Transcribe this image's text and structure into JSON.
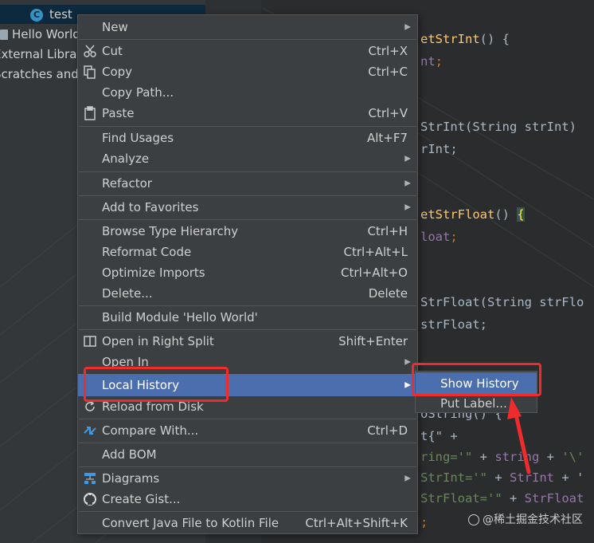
{
  "project_tree": {
    "items": [
      {
        "label": "test",
        "icon": "class-icon",
        "badge": "C"
      },
      {
        "label": "Hello World",
        "icon": "module-icon"
      },
      {
        "label": "External Libraries"
      },
      {
        "label": "Scratches and Consoles"
      }
    ]
  },
  "editor": {
    "code_lines": [
      {
        "seg": [
          {
            "t": "etStrInt",
            "c": "fn"
          },
          {
            "t": "() {",
            "c": ""
          }
        ]
      },
      {
        "seg": [
          {
            "t": "nt",
            "c": "field"
          },
          {
            "t": ";",
            "c": "kw"
          }
        ]
      },
      {
        "seg": [
          {
            "t": "StrInt(String strInt)",
            "c": ""
          }
        ]
      },
      {
        "seg": [
          {
            "t": "rInt;",
            "c": ""
          }
        ]
      },
      {
        "seg": [
          {
            "t": "etStrFloat",
            "c": "fn"
          },
          {
            "t": "() ",
            "c": ""
          },
          {
            "t": "{",
            "c": "brace"
          }
        ]
      },
      {
        "seg": [
          {
            "t": "loat",
            "c": "field"
          },
          {
            "t": ";",
            "c": "kw"
          }
        ]
      },
      {
        "seg": [
          {
            "t": "StrFloat(String strFlo",
            "c": ""
          }
        ]
      },
      {
        "seg": [
          {
            "t": "strFloat;",
            "c": ""
          }
        ]
      },
      {
        "seg": [
          {
            "t": "oString() {",
            "c": ""
          }
        ]
      },
      {
        "seg": [
          {
            "t": "t{\" +",
            "c": ""
          }
        ]
      },
      {
        "seg": [
          {
            "t": "ring='\"",
            "c": "str"
          },
          {
            "t": " + ",
            "c": ""
          },
          {
            "t": "string",
            "c": "field"
          },
          {
            "t": " + ",
            "c": ""
          },
          {
            "t": "'\\'",
            "c": "str"
          }
        ]
      },
      {
        "seg": [
          {
            "t": "StrInt='\"",
            "c": "str"
          },
          {
            "t": " + ",
            "c": ""
          },
          {
            "t": "StrInt",
            "c": "field"
          },
          {
            "t": " + '",
            "c": ""
          }
        ]
      },
      {
        "seg": [
          {
            "t": "StrFloat='\"",
            "c": "str"
          },
          {
            "t": " + ",
            "c": ""
          },
          {
            "t": "StrFloat",
            "c": "field"
          }
        ]
      },
      {
        "seg": [
          {
            "t": ";",
            "c": "kw"
          }
        ]
      }
    ]
  },
  "context_menu": {
    "items": [
      {
        "label": "New",
        "submenu": true
      },
      {
        "label": "Cut",
        "shortcut": "Ctrl+X",
        "icon": "scissors-icon"
      },
      {
        "label": "Copy",
        "shortcut": "Ctrl+C",
        "icon": "copy-icon"
      },
      {
        "label": "Copy Path..."
      },
      {
        "label": "Paste",
        "shortcut": "Ctrl+V",
        "icon": "clipboard-icon"
      },
      {
        "label": "Find Usages",
        "shortcut": "Alt+F7"
      },
      {
        "label": "Analyze",
        "submenu": true
      },
      {
        "label": "Refactor",
        "submenu": true
      },
      {
        "label": "Add to Favorites",
        "submenu": true
      },
      {
        "label": "Browse Type Hierarchy",
        "shortcut": "Ctrl+H"
      },
      {
        "label": "Reformat Code",
        "shortcut": "Ctrl+Alt+L"
      },
      {
        "label": "Optimize Imports",
        "shortcut": "Ctrl+Alt+O"
      },
      {
        "label": "Delete...",
        "shortcut": "Delete"
      },
      {
        "label": "Build Module 'Hello World'"
      },
      {
        "label": "Open in Right Split",
        "shortcut": "Shift+Enter",
        "icon": "split-icon"
      },
      {
        "label": "Open In",
        "submenu": true
      },
      {
        "label": "Local History",
        "submenu": true,
        "active": true
      },
      {
        "label": "Reload from Disk",
        "icon": "reload-icon"
      },
      {
        "label": "Compare With...",
        "shortcut": "Ctrl+D",
        "icon": "compare-icon"
      },
      {
        "label": "Add BOM"
      },
      {
        "label": "Diagrams",
        "submenu": true,
        "icon": "diagram-icon"
      },
      {
        "label": "Create Gist...",
        "icon": "github-icon"
      },
      {
        "label": "Convert Java File to Kotlin File",
        "shortcut": "Ctrl+Alt+Shift+K"
      }
    ]
  },
  "submenu": {
    "items": [
      {
        "label": "Show History",
        "active": true
      },
      {
        "label": "Put Label..."
      }
    ]
  },
  "colors": {
    "menu_bg": "#3c3f41",
    "selection": "#4b6eaf",
    "annotation": "#ef2b2b"
  },
  "watermark": "@稀土掘金技术社区"
}
